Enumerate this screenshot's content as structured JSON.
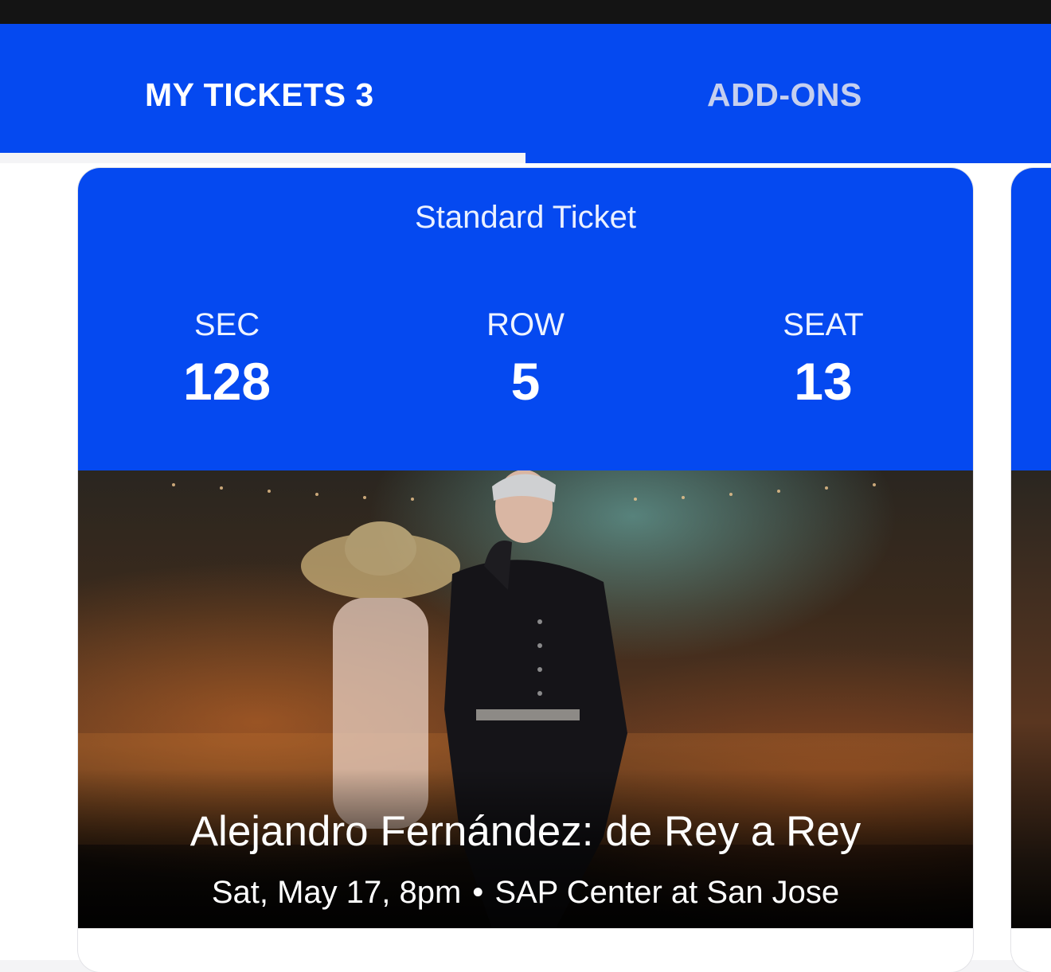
{
  "tabs": [
    {
      "label": "MY TICKETS 3",
      "active": true
    },
    {
      "label": "ADD-ONS",
      "active": false
    }
  ],
  "ticket": {
    "type": "Standard Ticket",
    "sec_label": "SEC",
    "sec_value": "128",
    "row_label": "ROW",
    "row_value": "5",
    "seat_label": "SEAT",
    "seat_value": "13"
  },
  "event": {
    "title": "Alejandro Fernández: de Rey a Rey",
    "date": "Sat, May 17, 8pm",
    "separator": "•",
    "venue": "SAP Center at San Jose"
  },
  "colors": {
    "brand_blue": "#0549f0",
    "tab_active": "#ffffff",
    "tab_inactive": "#c5cfef"
  }
}
